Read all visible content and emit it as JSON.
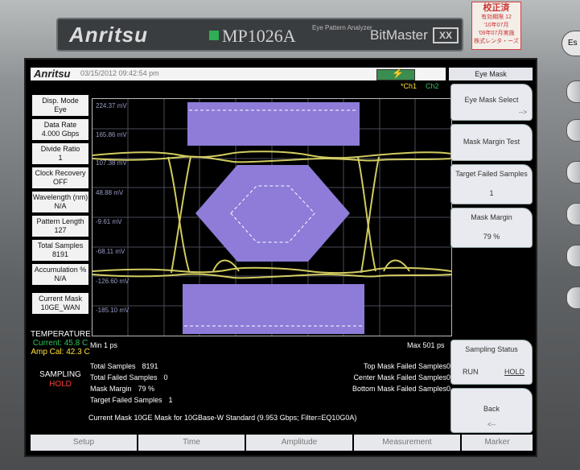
{
  "device": {
    "brand": "Anritsu",
    "model": "MP1026A",
    "subtitle": "Eye Pattern Analyzer",
    "series": "BitMaster",
    "series_logo": "XX",
    "esc_label": "Es",
    "sticker": {
      "title": "校正済",
      "line1": "有効期限 12",
      "line2": "'10年07月",
      "line3": "'09年07月実施",
      "line4": "株式レンタ・ーズ"
    }
  },
  "status_bar": {
    "logo": "Anritsu",
    "datetime": "03/15/2012 09:42:54 pm",
    "ch1": "*Ch1",
    "ch2": "Ch2"
  },
  "left_info": [
    {
      "label": "Disp. Mode",
      "value": "Eye"
    },
    {
      "label": "Data Rate",
      "value": "4.000 Gbps"
    },
    {
      "label": "Divide Ratio",
      "value": "1"
    },
    {
      "label": "Clock Recovery",
      "value": "OFF"
    },
    {
      "label": "Wavelength (nm)",
      "value": "N/A"
    },
    {
      "label": "Pattern Length",
      "value": "127"
    },
    {
      "label": "Total Samples",
      "value": "8191"
    },
    {
      "label": "Accumulation %",
      "value": "N/A"
    },
    {
      "label": "Current Mask",
      "value": "10GE_WAN"
    }
  ],
  "temperature": {
    "label": "TEMPERATURE",
    "current": "Current: 45.8 C",
    "amp_cal": "Amp Cal: 42.3 C"
  },
  "sampling": {
    "label": "SAMPLING",
    "state": "HOLD"
  },
  "plot": {
    "y_labels": [
      "224.37 mV",
      "165.86 mV",
      "107.38 mV",
      "48.88 mV",
      "-9.61 mV",
      "-68.11 mV",
      "-126.60 mV",
      "-185.10 mV"
    ],
    "x_min": "Min 1 ps",
    "x_max": "Max 501 ps",
    "trace_color": "#e8e26a",
    "mask_color": "#8e7cd8"
  },
  "stats_left": [
    {
      "label": "Total Samples",
      "value": "8191"
    },
    {
      "label": "Total Failed Samples",
      "value": "0"
    },
    {
      "label": "Mask Margin",
      "value": "79 %"
    },
    {
      "label": "Target Failed Samples",
      "value": "1"
    }
  ],
  "stats_right": [
    {
      "label": "Top Mask Failed Samples",
      "value": "0"
    },
    {
      "label": "Center Mask Failed Samples",
      "value": "0"
    },
    {
      "label": "Bottom Mask Failed Samples",
      "value": "0"
    }
  ],
  "current_mask_line": "Current Mask  10GE Mask for 10GBase-W Standard (9.953 Gbps; Filter=EQ10G0A)",
  "right_panel": {
    "title": "Eye Mask",
    "buttons": [
      {
        "label": "Eye Mask Select",
        "sub": "-->"
      },
      {
        "label": "Mask Margin Test",
        "sub": ""
      },
      {
        "label": "Target Failed Samples",
        "sub": "1"
      },
      {
        "label": "Mask Margin",
        "sub": "79 %"
      }
    ],
    "sampling_status": {
      "label": "Sampling Status",
      "run": "RUN",
      "hold": "HOLD"
    },
    "back": {
      "label": "Back",
      "sub": "<--"
    }
  },
  "bottom_tabs": [
    "Setup",
    "Time",
    "Amplitude",
    "Measurement",
    "Marker"
  ]
}
